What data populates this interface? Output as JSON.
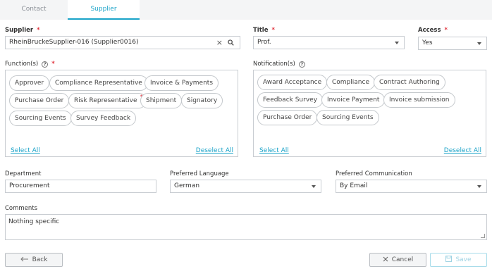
{
  "tabs": {
    "contact": "Contact",
    "supplier": "Supplier"
  },
  "supplier": {
    "label": "Supplier",
    "required": "*",
    "value": "RheinBruckeSupplier-016 (Supplier0016)",
    "clear": "×"
  },
  "title": {
    "label": "Title",
    "required": "*",
    "value": "Prof."
  },
  "access": {
    "label": "Access",
    "required": "*",
    "value": "Yes"
  },
  "functions": {
    "label": "Function(s)",
    "required": "*",
    "info": "?",
    "chips": [
      "Approver",
      "Compliance Representative",
      "Invoice & Payments",
      "Purchase Order",
      "Risk Representative",
      "Shipment",
      "Signatory",
      "Sourcing Events",
      "Survey Feedback"
    ],
    "marked_chip_dot": "*",
    "select_all": "Select All",
    "deselect_all": "Deselect All"
  },
  "notifications": {
    "label": "Notification(s)",
    "info": "?",
    "chips": [
      "Award Acceptance",
      "Compliance",
      "Contract Authoring",
      "Feedback Survey",
      "Invoice Payment",
      "Invoice submission",
      "Purchase Order",
      "Sourcing Events"
    ],
    "select_all": "Select All",
    "deselect_all": "Deselect All"
  },
  "department": {
    "label": "Department",
    "value": "Procurement"
  },
  "preferred_language": {
    "label": "Preferred Language",
    "value": "German"
  },
  "preferred_communication": {
    "label": "Preferred Communication",
    "value": "By Email"
  },
  "comments": {
    "label": "Comments",
    "value": "Nothing specific"
  },
  "buttons": {
    "back": "Back",
    "cancel": "Cancel",
    "save": "Save"
  },
  "colors": {
    "accent": "#1aa3c8",
    "required": "#e0303a",
    "border": "#c9cdd2"
  }
}
